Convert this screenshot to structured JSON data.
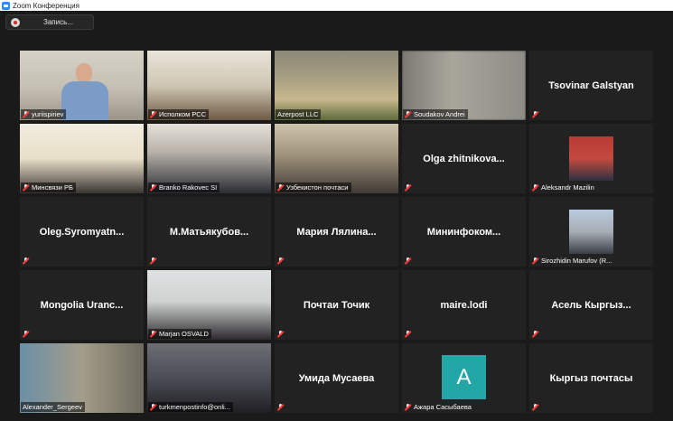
{
  "window": {
    "title": "Zoom Конференция"
  },
  "toolbar": {
    "record_label": "Запись..."
  },
  "colors": {
    "active_speaker_border": "#c8dc3c",
    "avatar_bg": "#22a6a6",
    "muted_icon": "#ff3b3b"
  },
  "tiles": [
    {
      "label": "yuriispiriev"
    },
    {
      "label": "Исполком РСС"
    },
    {
      "label": "Azerpost LLC",
      "speaking": true
    },
    {
      "label": "Soudakov Andrei"
    },
    {
      "center_name": "Tsovinar Galstyan"
    },
    {
      "label": "Минсвязи РБ"
    },
    {
      "label": "Branko Rakovec SI"
    },
    {
      "label": "Узбекистон почтаси"
    },
    {
      "center_name": "Olga zhitnikova..."
    },
    {
      "label": "Aleksandr Mazilin"
    },
    {
      "center_name": "Oleg.Syromyatn..."
    },
    {
      "center_name": "М.Матьякубов..."
    },
    {
      "center_name": "Мария Лялина..."
    },
    {
      "center_name": "Мининфоком..."
    },
    {
      "label": "Sirozhidin Marufov (R..."
    },
    {
      "center_name": "Mongolia Uranc..."
    },
    {
      "label": "Marjan OSVALD"
    },
    {
      "center_name": "Почтаи Точик"
    },
    {
      "center_name": "maire.lodi"
    },
    {
      "center_name": "Асель Кыргыз..."
    },
    {
      "label": "Alexander_Sergeev"
    },
    {
      "label": "turkmenpostinfo@onli..."
    },
    {
      "center_name": "Умида Мусаева"
    },
    {
      "label": "Ажара Сасыбаева",
      "avatar_letter": "A"
    },
    {
      "center_name": "Кыргыз почтасы"
    }
  ]
}
